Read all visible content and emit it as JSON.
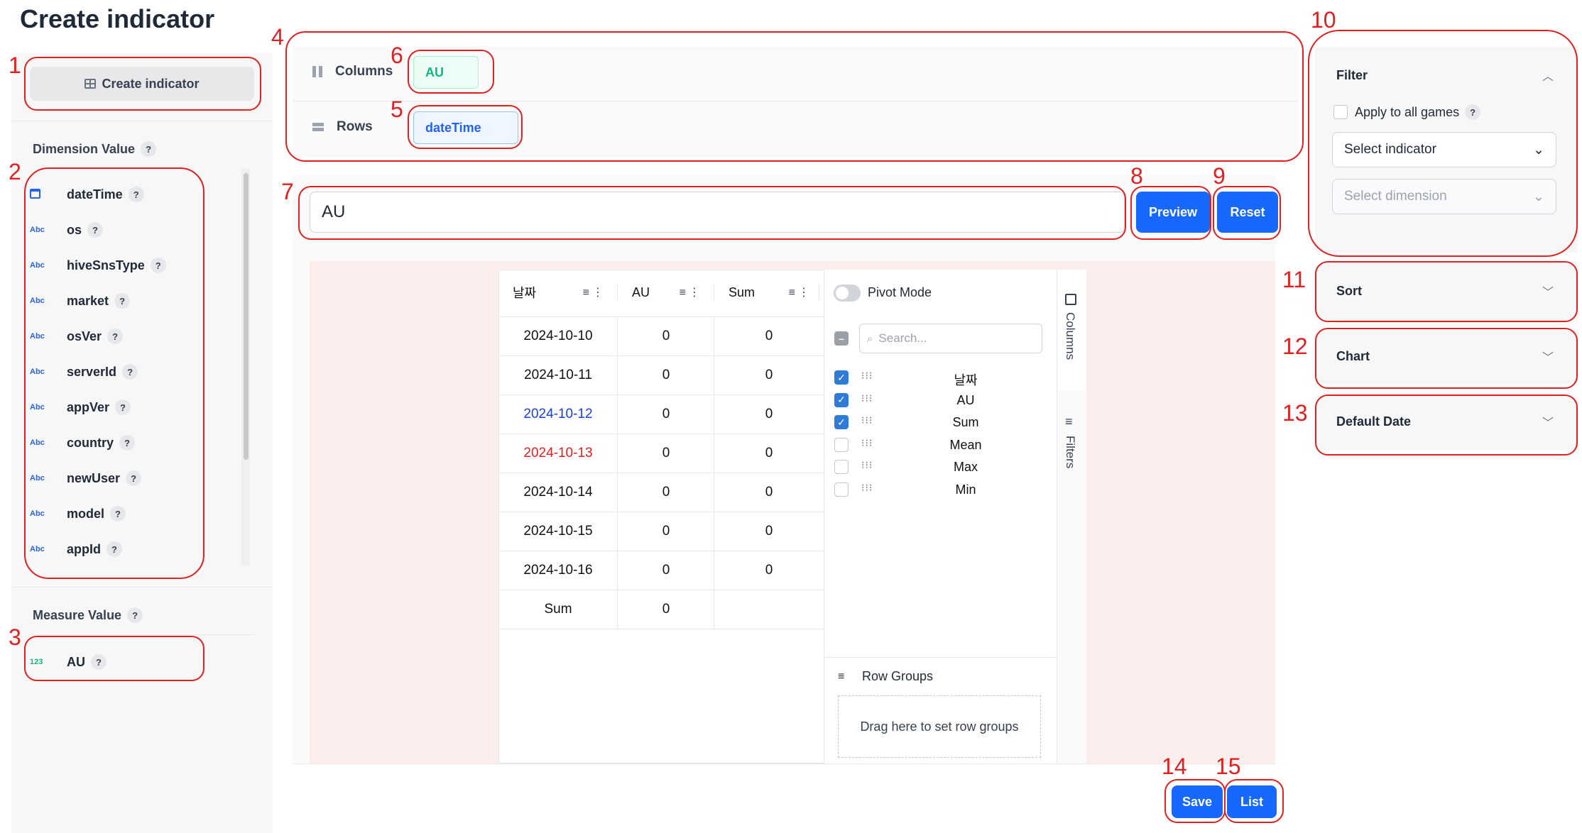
{
  "page_title": "Create indicator",
  "sidebar": {
    "create_button": "Create indicator",
    "dimension_label": "Dimension Value",
    "dimensions": [
      {
        "type": "cal",
        "name": "dateTime"
      },
      {
        "type": "Abc",
        "name": "os"
      },
      {
        "type": "Abc",
        "name": "hiveSnsType"
      },
      {
        "type": "Abc",
        "name": "market"
      },
      {
        "type": "Abc",
        "name": "osVer"
      },
      {
        "type": "Abc",
        "name": "serverId"
      },
      {
        "type": "Abc",
        "name": "appVer"
      },
      {
        "type": "Abc",
        "name": "country"
      },
      {
        "type": "Abc",
        "name": "newUser"
      },
      {
        "type": "Abc",
        "name": "model"
      },
      {
        "type": "Abc",
        "name": "appId"
      }
    ],
    "measure_label": "Measure Value",
    "measures": [
      {
        "type": "123",
        "name": "AU"
      }
    ],
    "help": "?"
  },
  "layout_panel": {
    "columns_label": "Columns",
    "rows_label": "Rows",
    "column_chip": "AU",
    "row_chip": "dateTime"
  },
  "indicator_input": "AU",
  "buttons": {
    "preview": "Preview",
    "reset": "Reset",
    "save": "Save",
    "list": "List"
  },
  "grid": {
    "headers": [
      "날짜",
      "AU",
      "Sum"
    ],
    "rows": [
      {
        "date": "2024-10-10",
        "au": "0",
        "sum": "0",
        "color": "#111111"
      },
      {
        "date": "2024-10-11",
        "au": "0",
        "sum": "0",
        "color": "#111111"
      },
      {
        "date": "2024-10-12",
        "au": "0",
        "sum": "0",
        "color": "#1a3fd6"
      },
      {
        "date": "2024-10-13",
        "au": "0",
        "sum": "0",
        "color": "#e02020"
      },
      {
        "date": "2024-10-14",
        "au": "0",
        "sum": "0",
        "color": "#111111"
      },
      {
        "date": "2024-10-15",
        "au": "0",
        "sum": "0",
        "color": "#111111"
      },
      {
        "date": "2024-10-16",
        "au": "0",
        "sum": "0",
        "color": "#111111"
      }
    ],
    "total_row": {
      "label": "Sum",
      "au": "0",
      "sum": ""
    }
  },
  "tool_panel": {
    "pivot_mode": "Pivot Mode",
    "search_placeholder": "Search...",
    "columns": [
      {
        "name": "날짜",
        "checked": true
      },
      {
        "name": "AU",
        "checked": true
      },
      {
        "name": "Sum",
        "checked": true
      },
      {
        "name": "Mean",
        "checked": false
      },
      {
        "name": "Max",
        "checked": false
      },
      {
        "name": "Min",
        "checked": false
      }
    ],
    "row_groups_label": "Row Groups",
    "row_groups_drop": "Drag here to set row groups",
    "tabs": [
      "Columns",
      "Filters"
    ]
  },
  "right_panel": {
    "filter_title": "Filter",
    "apply_all": "Apply to all games",
    "select_indicator": "Select indicator",
    "select_dimension": "Select dimension",
    "sort_title": "Sort",
    "chart_title": "Chart",
    "default_date_title": "Default Date"
  },
  "annotations": [
    "1",
    "2",
    "3",
    "4",
    "5",
    "6",
    "7",
    "8",
    "9",
    "10",
    "11",
    "12",
    "13",
    "14",
    "15"
  ],
  "colors": {
    "accent": "#1668ff",
    "annotation": "#e02020",
    "green": "#10b981",
    "blue": "#2563eb"
  }
}
